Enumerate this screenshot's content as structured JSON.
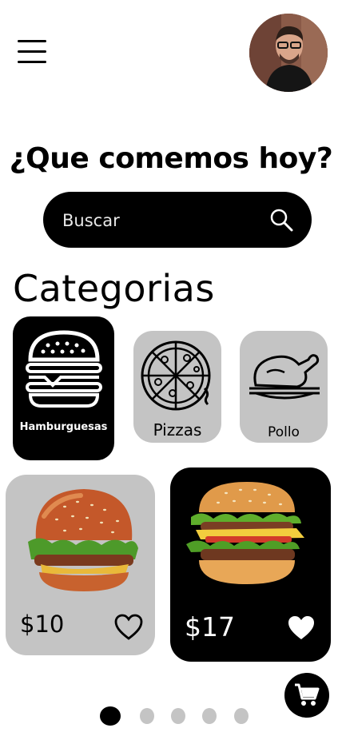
{
  "header": {
    "title": "¿Que comemos hoy?",
    "menu_icon": "hamburger-menu-icon",
    "avatar_icon": "user-avatar"
  },
  "search": {
    "placeholder": "Buscar",
    "value": "",
    "icon": "search-icon"
  },
  "categories": {
    "title": "Categorias",
    "items": [
      {
        "label": "Hamburguesas",
        "icon": "burger-icon",
        "selected": true
      },
      {
        "label": "Pizzas",
        "icon": "pizza-icon",
        "selected": false
      },
      {
        "label": "Pollo",
        "icon": "roast-chicken-icon",
        "selected": false
      }
    ]
  },
  "products": [
    {
      "price": "$10",
      "favorite": false,
      "image": "burger-photo"
    },
    {
      "price": "$17",
      "favorite": true,
      "image": "burger-photo"
    }
  ],
  "cart": {
    "icon": "shopping-cart-icon"
  },
  "pagination": {
    "count": 5,
    "active": 1
  },
  "colors": {
    "accent": "#000000",
    "card_gray": "#c4c4c4",
    "background": "#ffffff"
  }
}
